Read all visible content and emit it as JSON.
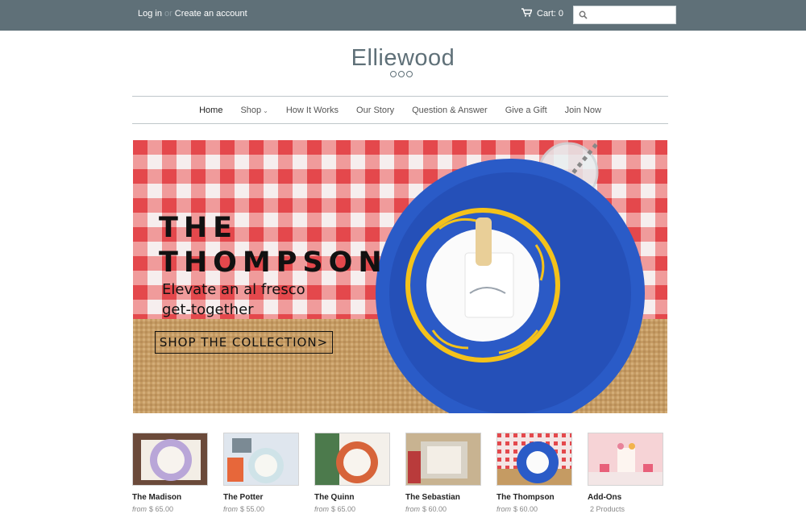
{
  "header": {
    "login_label": "Log in",
    "or_label": "or",
    "create_account_label": "Create an account",
    "cart_label": "Cart: 0",
    "search_placeholder": ""
  },
  "brand": {
    "name": "Elliewood"
  },
  "nav": {
    "items": [
      {
        "label": "Home"
      },
      {
        "label": "Shop"
      },
      {
        "label": "How It Works"
      },
      {
        "label": "Our Story"
      },
      {
        "label": "Question & Answer"
      },
      {
        "label": "Give a Gift"
      },
      {
        "label": "Join Now"
      }
    ]
  },
  "hero": {
    "title": "THE\nTHOMPSON",
    "subtitle": "Elevate an al fresco get-together",
    "cta_label": "SHOP THE COLLECTION>"
  },
  "products": [
    {
      "name": "The Madison",
      "from": "from",
      "price": "$ 65.00"
    },
    {
      "name": "The Potter",
      "from": "from",
      "price": "$ 55.00"
    },
    {
      "name": "The Quinn",
      "from": "from",
      "price": "$ 65.00"
    },
    {
      "name": "The Sebastian",
      "from": "from",
      "price": "$ 60.00"
    },
    {
      "name": "The Thompson",
      "from": "from",
      "price": "$ 60.00"
    },
    {
      "name": "Add-Ons",
      "from": "",
      "price": "2 Products"
    }
  ],
  "colors": {
    "topbar": "#5f7078",
    "gingham_red": "#e85a5a",
    "burlap": "#c9a26b",
    "plate_blue": "#2a5bc7"
  }
}
